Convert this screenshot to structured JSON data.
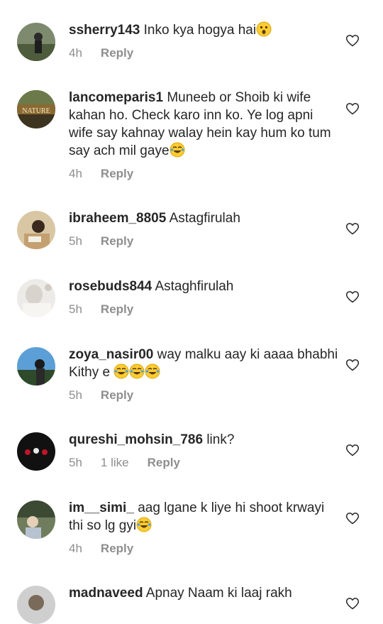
{
  "comments": [
    {
      "username": "ssherry143",
      "text": "Inko kya hogya hai",
      "emoji": "astonished",
      "time": "4h",
      "likes": "",
      "reply": "Reply"
    },
    {
      "username": "lancomeparis1",
      "text": "Muneeb or Shoib ki wife kahan ho. Check karo inn ko. Ye log apni wife say kahnay walay hein kay hum ko tum say ach mil gaye",
      "emoji": "joy",
      "time": "4h",
      "likes": "",
      "reply": "Reply",
      "avatar_text": "NATURE"
    },
    {
      "username": "ibraheem_8805",
      "text": "Astagfirulah",
      "time": "5h",
      "likes": "",
      "reply": "Reply"
    },
    {
      "username": "rosebuds844",
      "text": "Astaghfirulah",
      "time": "5h",
      "likes": "",
      "reply": "Reply"
    },
    {
      "username": "zoya_nasir00",
      "text": "way malku aay ki aaaa bhabhi Kithy e",
      "emoji": "joy x3",
      "time": "5h",
      "likes": "",
      "reply": "Reply"
    },
    {
      "username": "qureshi_mohsin_786",
      "text": "link?",
      "time": "5h",
      "likes": "1 like",
      "reply": "Reply"
    },
    {
      "username": "im__simi_",
      "text": "aag lgane k liye hi shoot krwayi thi so lg gyi",
      "emoji": "joy",
      "time": "4h",
      "likes": "",
      "reply": "Reply"
    },
    {
      "username": "madnaveed",
      "text": "Apnay Naam ki laaj rakh",
      "time": "",
      "likes": "",
      "reply": ""
    }
  ],
  "icons": {
    "like": "heart-outline-icon"
  },
  "colors": {
    "text": "#262626",
    "meta": "#8e8e8e",
    "background": "#ffffff"
  }
}
